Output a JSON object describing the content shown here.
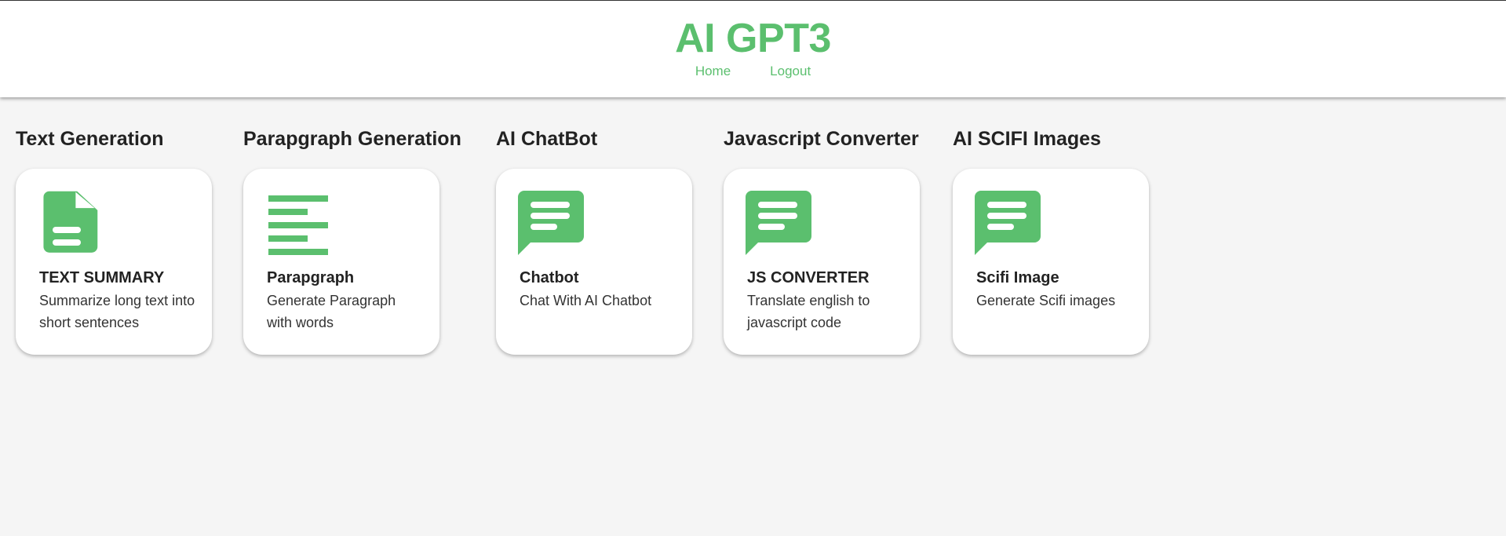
{
  "header": {
    "title": "AI GPT3",
    "nav": {
      "home": "Home",
      "logout": "Logout"
    },
    "accent_color": "#5bbf6e"
  },
  "sections": [
    {
      "heading": "Text Generation",
      "card": {
        "icon": "document-icon",
        "title": "TEXT SUMMARY",
        "description": "Summarize long text into short sentences"
      }
    },
    {
      "heading": "Parapgraph Generation",
      "card": {
        "icon": "align-left-icon",
        "title": "Parapgraph",
        "description": "Generate Paragraph with words"
      }
    },
    {
      "heading": "AI ChatBot",
      "card": {
        "icon": "chat-bubble-icon",
        "title": "Chatbot",
        "description": "Chat With AI Chatbot"
      }
    },
    {
      "heading": "Javascript Converter",
      "card": {
        "icon": "chat-bubble-icon",
        "title": "JS CONVERTER",
        "description": "Translate english to javascript code"
      }
    },
    {
      "heading": "AI SCIFI Images",
      "card": {
        "icon": "chat-bubble-icon",
        "title": "Scifi Image",
        "description": "Generate Scifi images"
      }
    }
  ]
}
